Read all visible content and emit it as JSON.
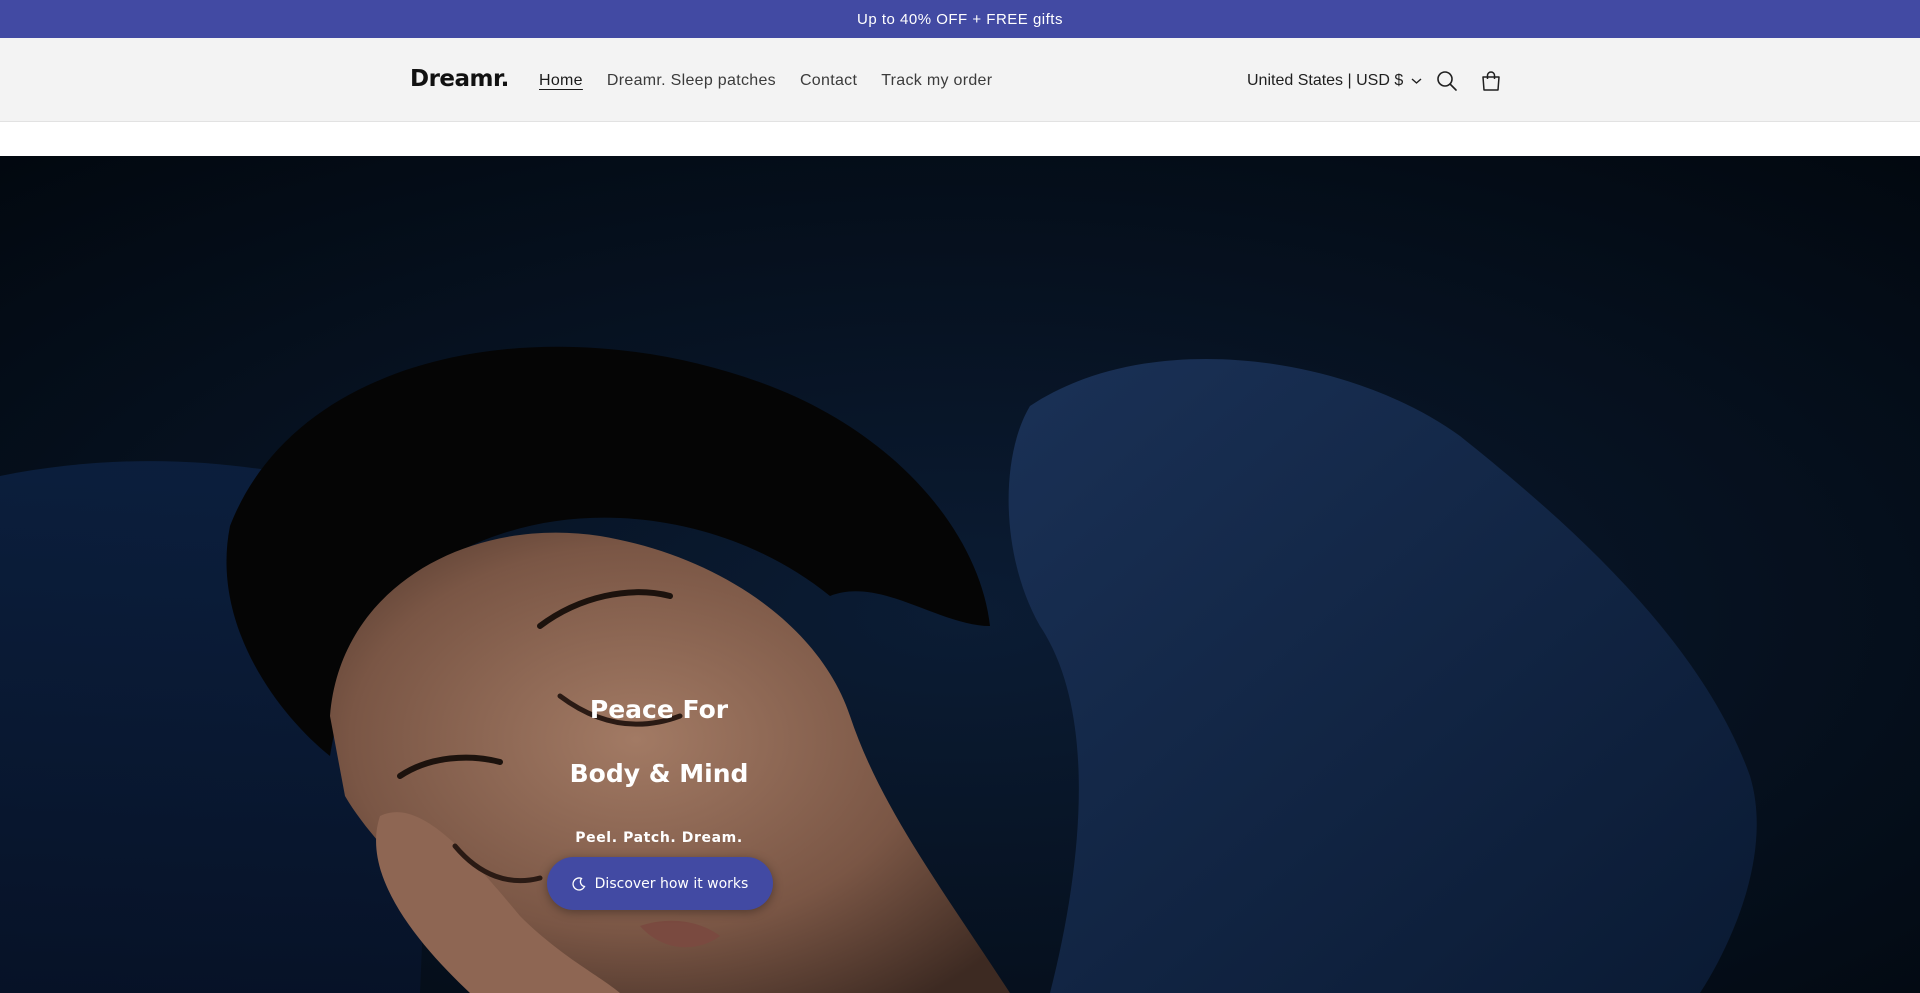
{
  "announcement": {
    "text": "Up to 40% OFF + FREE gifts"
  },
  "header": {
    "logo": "Dreamr.",
    "nav": [
      {
        "label": "Home",
        "active": true
      },
      {
        "label": "Dreamr. Sleep patches",
        "active": false
      },
      {
        "label": "Contact",
        "active": false
      },
      {
        "label": "Track my order",
        "active": false
      }
    ],
    "locale": "United States | USD $",
    "icons": [
      "chevron-down-icon",
      "search-icon",
      "cart-icon"
    ]
  },
  "hero": {
    "title_line1": "Peace For",
    "title_line2": "Body & Mind",
    "subtitle": "Peel. Patch. Dream.",
    "cta_label": "Discover how it works",
    "cta_icon": "moon-icon"
  },
  "colors": {
    "accent": "#424aa3",
    "header_bg": "#f3f3f3",
    "hero_bg": "#031021",
    "text_dark": "#1a1a1a"
  }
}
